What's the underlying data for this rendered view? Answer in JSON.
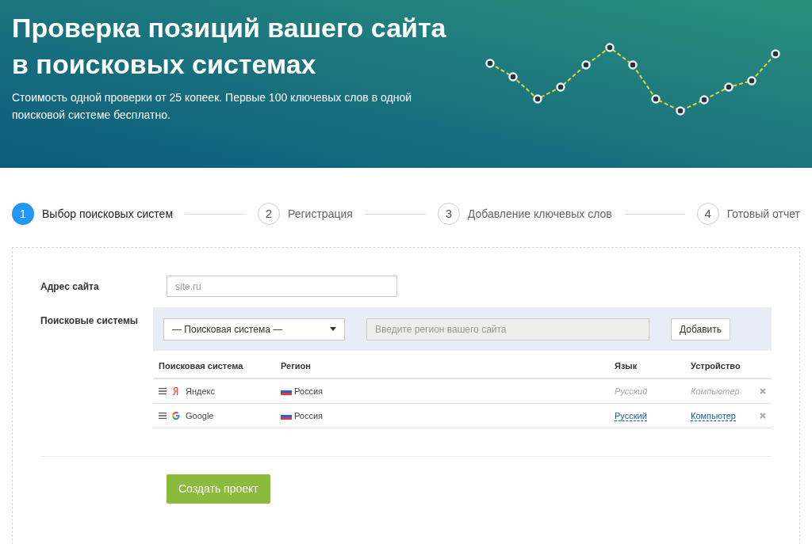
{
  "hero": {
    "title": "Проверка позиций вашего сайта в поисковых системах",
    "subtitle": "Стоимость одной проверки от 25 копеек. Первые 100 ключевых слов в одной поисковой системе бесплатно."
  },
  "steps": [
    {
      "number": "1",
      "label": "Выбор поисковых систем",
      "selected": true
    },
    {
      "number": "2",
      "label": "Регистрация",
      "selected": false
    },
    {
      "number": "3",
      "label": "Добавление ключевых слов",
      "selected": false
    },
    {
      "number": "4",
      "label": "Готовый отчет",
      "selected": false
    }
  ],
  "form": {
    "site_label": "Адрес сайта",
    "site_placeholder": "site.ru",
    "engines_label": "Поисковые системы",
    "engine_select": "— Поисковая система —",
    "region_placeholder": "Введите регион вашего сайта",
    "add_button": "Добавить",
    "columns": [
      "Поисковая система",
      "Регион",
      "Язык",
      "Устройство"
    ],
    "rows": [
      {
        "kind": "yandex",
        "engine": "Яндекс",
        "region": "Россия",
        "language": "Русский",
        "device": "Компьютер",
        "disabled": true
      },
      {
        "kind": "google",
        "engine": "Google",
        "region": "Россия",
        "language": "Русский",
        "device": "Компьютер",
        "disabled": false
      }
    ],
    "submit_button": "Создать проект"
  }
}
